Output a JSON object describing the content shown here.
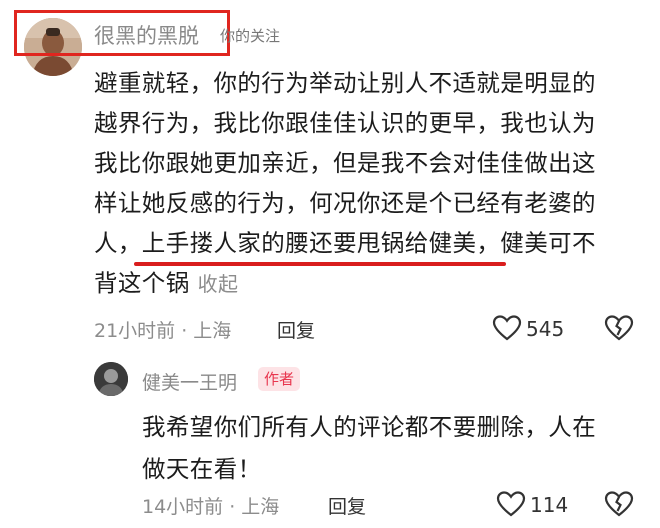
{
  "comment": {
    "username": "很黑的黑脱",
    "follow_tag": "你的关注",
    "lines": [
      "避重就轻，你的行为举动让别人不适就是明显的",
      "越界行为，我比你跟佳佳认识的更早，我也认为",
      "我比你跟她更加亲近，但是我不会对佳佳做出这",
      "样让她反感的行为，何况你还是个已经有老婆的",
      "人，上手搂人家的腰还要甩锅给健美，健美可不",
      "背这个锅"
    ],
    "collapse_label": "收起",
    "time_location": "21小时前 · 上海",
    "reply_label": "回复",
    "like_count": "545"
  },
  "reply": {
    "username": "健美一王明",
    "badge": "作者",
    "lines": [
      "我希望你们所有人的评论都不要删除，人在",
      "做天在看！"
    ],
    "time_location": "14小时前 · 上海",
    "reply_label": "回复",
    "like_count": "114"
  },
  "colors": {
    "highlight_red": "#e0261f",
    "underline_red": "#d91d1d",
    "badge_bg": "#fde3e6",
    "badge_text": "#e8364e"
  },
  "icons": [
    "avatar",
    "heart-icon",
    "broken-heart-icon"
  ]
}
